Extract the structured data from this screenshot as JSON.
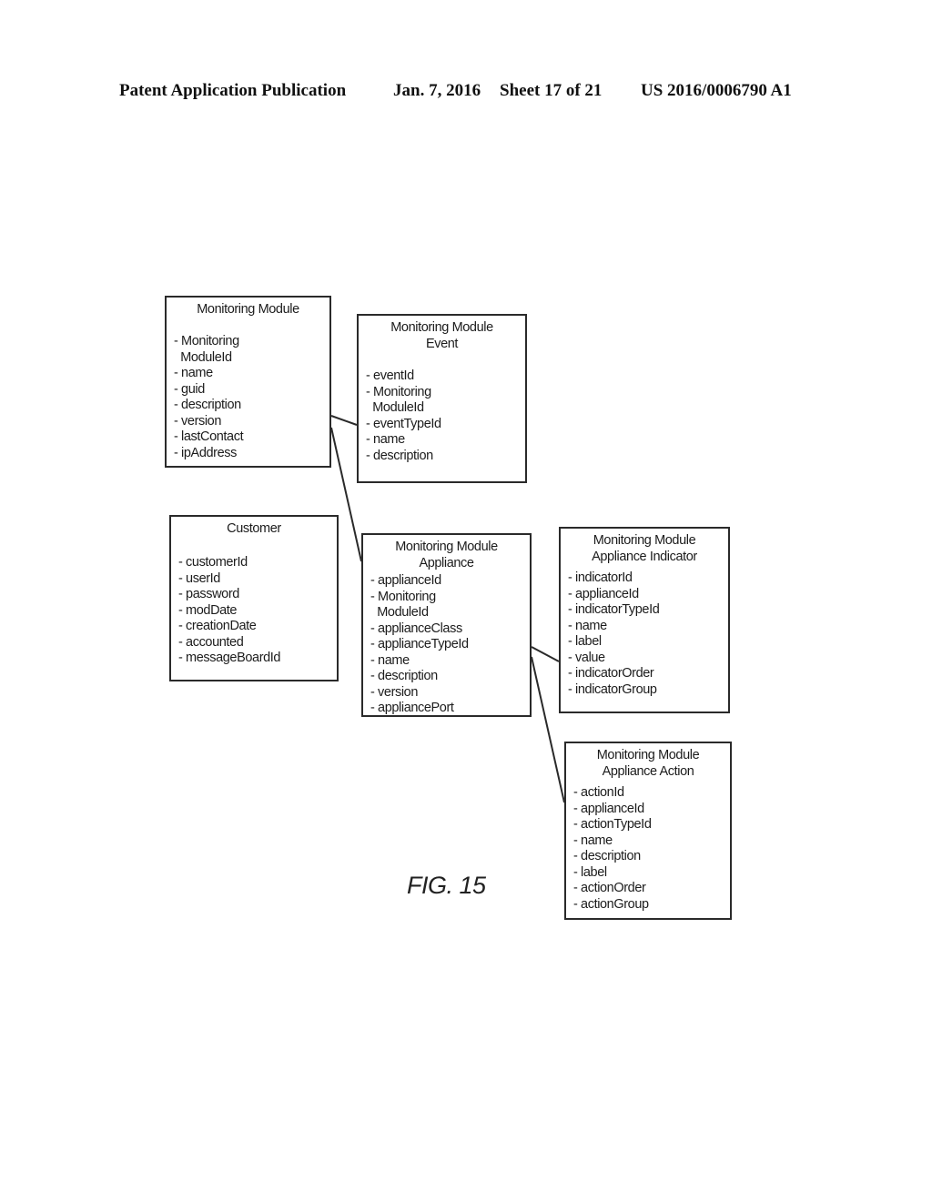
{
  "header": {
    "publication": "Patent Application Publication",
    "date": "Jan. 7, 2016",
    "sheet": "Sheet 17 of 21",
    "number": "US 2016/0006790 A1"
  },
  "figure_label": "FIG. 15",
  "entities": {
    "monitoring_module": {
      "title": "Monitoring Module",
      "fields": [
        "- Monitoring",
        "  ModuleId",
        "- name",
        "- guid",
        "- description",
        "- version",
        "- lastContact",
        "- ipAddress"
      ]
    },
    "monitoring_module_event": {
      "title_line1": "Monitoring Module",
      "title_line2": "Event",
      "fields": [
        "- eventId",
        "- Monitoring",
        "  ModuleId",
        "- eventTypeId",
        "- name",
        "- description"
      ]
    },
    "customer": {
      "title": "Customer",
      "fields": [
        "- customerId",
        "- userId",
        "- password",
        "- modDate",
        "- creationDate",
        "- accounted",
        "- messageBoardId"
      ]
    },
    "monitoring_module_appliance": {
      "title_line1": "Monitoring Module",
      "title_line2": "Appliance",
      "fields": [
        "- applianceId",
        "- Monitoring",
        "  ModuleId",
        "- applianceClass",
        "- applianceTypeId",
        "- name",
        "- description",
        "- version",
        "- appliancePort"
      ]
    },
    "monitoring_module_appliance_indicator": {
      "title_line1": "Monitoring Module",
      "title_line2": "Appliance Indicator",
      "fields": [
        "- indicatorId",
        "- applianceId",
        "- indicatorTypeId",
        "- name",
        "- label",
        "- value",
        "- indicatorOrder",
        "- indicatorGroup"
      ]
    },
    "monitoring_module_appliance_action": {
      "title_line1": "Monitoring Module",
      "title_line2": "Appliance Action",
      "fields": [
        "- actionId",
        "- applianceId",
        "- actionTypeId",
        "- name",
        "- description",
        "- label",
        "- actionOrder",
        "- actionGroup"
      ]
    }
  },
  "relations": [
    {
      "from": "monitoring_module",
      "to": "monitoring_module_event"
    },
    {
      "from": "monitoring_module",
      "to": "monitoring_module_appliance"
    },
    {
      "from": "monitoring_module_appliance",
      "to": "monitoring_module_appliance_indicator"
    },
    {
      "from": "monitoring_module_appliance",
      "to": "monitoring_module_appliance_action"
    }
  ]
}
